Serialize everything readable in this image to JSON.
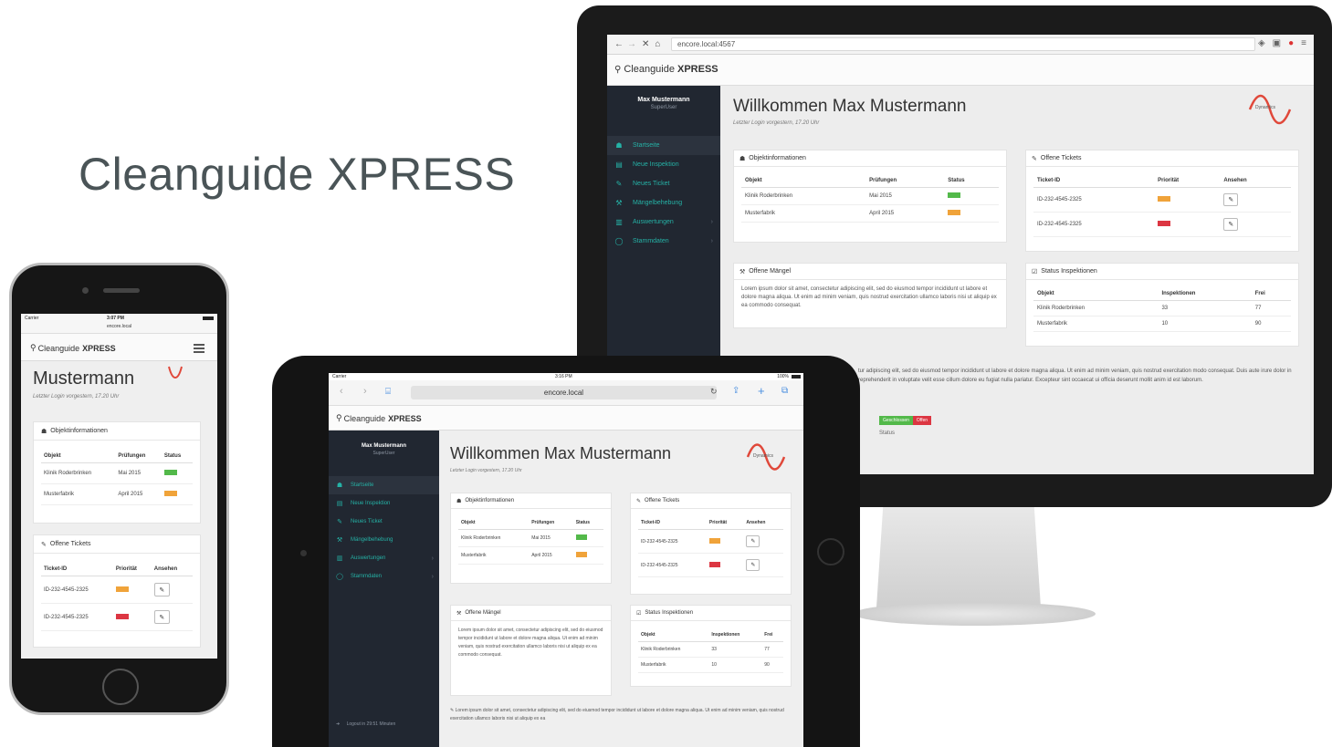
{
  "hero": {
    "title": "Cleanguide XPRESS"
  },
  "app": {
    "brand_prefix": "Cleanguide",
    "brand_bold": "XPRESS",
    "user_name": "Max Mustermann",
    "user_role": "SuperUser",
    "welcome": "Willkommen Max Mustermann",
    "welcome_short": "Mustermann",
    "last_login": "Letzter Login vorgestern, 17.20 Uhr",
    "logo_text": "Dynamics",
    "nav": [
      {
        "label": "Startseite",
        "icon": "home-icon"
      },
      {
        "label": "Neue Inspektion",
        "icon": "document-icon"
      },
      {
        "label": "Neues Ticket",
        "icon": "pin-icon"
      },
      {
        "label": "Mängelbehebung",
        "icon": "wrench-icon"
      },
      {
        "label": "Auswertungen",
        "icon": "chart-icon"
      },
      {
        "label": "Stammdaten",
        "icon": "globe-icon"
      }
    ],
    "logout": "Logout in 29:51 Minuten",
    "objekt_panel": {
      "title": "Objektinformationen",
      "headers": [
        "Objekt",
        "Prüfungen",
        "Status"
      ],
      "rows": [
        {
          "objekt": "Klinik Roderbrinken",
          "pruefung": "Mai 2015",
          "status": "green"
        },
        {
          "objekt": "Musterfabrik",
          "pruefung": "April 2015",
          "status": "orange"
        }
      ]
    },
    "tickets_panel": {
      "title": "Offene Tickets",
      "headers": [
        "Ticket-ID",
        "Priorität",
        "Ansehen"
      ],
      "rows": [
        {
          "id": "ID-232-4545-2325",
          "prio": "orange"
        },
        {
          "id": "ID-232-4545-2325",
          "prio": "red"
        }
      ]
    },
    "maengel_panel": {
      "title": "Offene Mängel",
      "text": "Lorem ipsum dolor sit amet, consectetur adipiscing elit, sed do eiusmod tempor incididunt ut labore et dolore magna aliqua. Ut enim ad minim veniam, quis nostrud exercitation ullamco laboris nisi ut aliquip ex ea commodo consequat."
    },
    "inspektion_panel": {
      "title": "Status Inspektionen",
      "headers": [
        "Objekt",
        "Inspektionen",
        "Frei"
      ],
      "rows": [
        {
          "objekt": "Klinik Roderbrinken",
          "inspektionen": "33",
          "frei": "77"
        },
        {
          "objekt": "Musterfabrik",
          "inspektionen": "10",
          "frei": "90"
        }
      ]
    },
    "bottom_text": "tur adipiscing elit, sed do eiusmod tempor incididunt ut labore et dolore magna aliqua. Ut enim ad minim veniam, quis nostrud exercitation modo consequat. Duis aute irure dolor in reprehenderit in voluptate velit esse cillum dolore eu fugiat nulla pariatur. Excepteur sint occaecat ui officia deserunt mollit anim id est laborum.",
    "tablet_bottom_text": "Lorem ipsum dolor sit amet, consectetur adipiscing elit, sed do eiusmod tempor incididunt ut labore et dolore magna aliqua. Ut enim ad minim veniam, quis nostrud exercitation ullamco laboris nisi ut aliquip ex ea",
    "status_tags": {
      "done": "Geschlossen",
      "open": "Offen",
      "caption": "Status"
    }
  },
  "monitor_browser": {
    "url": "encore.local:4567"
  },
  "tablet_browser": {
    "carrier": "Carrier",
    "time": "3:16 PM",
    "battery": "100%",
    "url": "encore.local"
  },
  "phone_browser": {
    "carrier": "Carrier",
    "time": "3:07 PM",
    "url": "encore.local"
  },
  "colors": {
    "teal": "#25b2a6",
    "sidebar": "#212731",
    "green": "#53b94a",
    "orange": "#f0a33a",
    "red": "#dc3642"
  }
}
